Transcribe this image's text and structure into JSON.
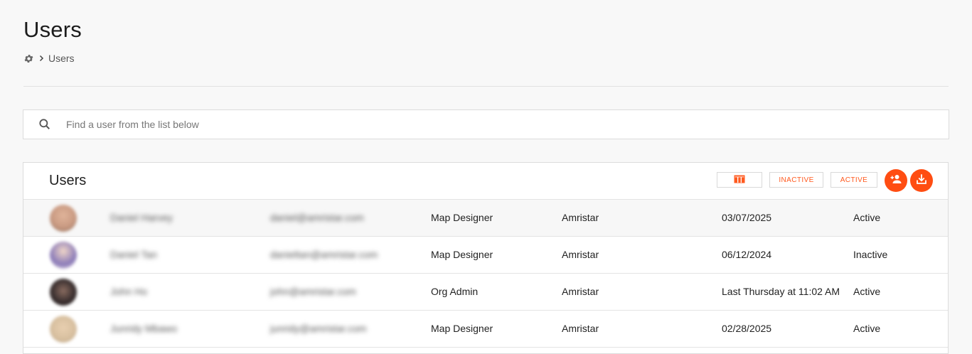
{
  "header": {
    "title": "Users",
    "breadcrumb": {
      "current": "Users"
    }
  },
  "search": {
    "placeholder": "Find a user from the list below",
    "value": ""
  },
  "panel": {
    "title": "Users",
    "buttons": {
      "columns_icon": "columns-icon",
      "inactive": "INACTIVE",
      "active": "ACTIVE",
      "add_user_icon": "add-user-icon",
      "download_icon": "download-icon"
    }
  },
  "users": [
    {
      "name": "Daniel Harvey",
      "email": "daniel@amristar.com",
      "role": "Map Designer",
      "org": "Amristar",
      "last_login": "03/07/2025",
      "status": "Active",
      "avatar_color": "#c99a82"
    },
    {
      "name": "Daniel Tan",
      "email": "danieltan@amristar.com",
      "role": "Map Designer",
      "org": "Amristar",
      "last_login": "06/12/2024",
      "status": "Inactive",
      "avatar_color": "#8a7ab8"
    },
    {
      "name": "John Ho",
      "email": "john@amristar.com",
      "role": "Org Admin",
      "org": "Amristar",
      "last_login": "Last Thursday at 11:02 AM",
      "status": "Active",
      "avatar_color": "#3b3030"
    },
    {
      "name": "Junridy Mbawo",
      "email": "junridy@amristar.com",
      "role": "Map Designer",
      "org": "Amristar",
      "last_login": "02/28/2025",
      "status": "Active",
      "avatar_color": "#d8c0a0"
    }
  ],
  "colors": {
    "accent": "#ff4d12",
    "background": "#f8f8f8"
  }
}
